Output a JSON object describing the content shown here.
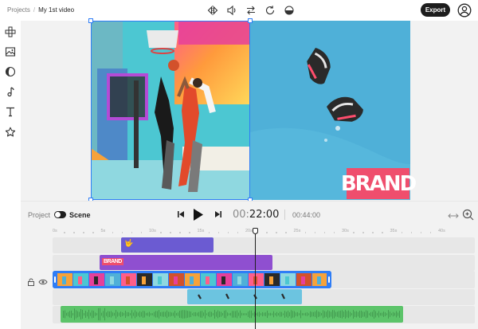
{
  "breadcrumb": {
    "parent": "Projects",
    "separator": "/",
    "current": "My 1st video"
  },
  "toolbar": {
    "icons": [
      "flip-horizontal-icon",
      "volume-icon",
      "swap-icon",
      "rotate-icon",
      "opacity-icon"
    ],
    "export_label": "Export",
    "account_icon": "user-circle-icon"
  },
  "sidebar": {
    "items": [
      {
        "name": "elements",
        "icon": "elements-icon"
      },
      {
        "name": "media",
        "icon": "media-icon"
      },
      {
        "name": "filters",
        "icon": "filter-icon"
      },
      {
        "name": "music",
        "icon": "music-note-icon"
      },
      {
        "name": "text",
        "icon": "text-icon"
      },
      {
        "name": "stickers",
        "icon": "star-icon"
      }
    ]
  },
  "canvas": {
    "brand_text": "BRAND",
    "brand_color": "#ef4e6d",
    "accent": "#2f7df6"
  },
  "controls": {
    "project_label": "Project",
    "scene_label": "Scene",
    "scene_toggle_on": true,
    "current_time_prefix": "00:",
    "current_time_main": "22:00",
    "total_time": "00:44:00"
  },
  "timeline": {
    "ticks": [
      "0s",
      "5s",
      "10s",
      "15s",
      "20s",
      "25s",
      "30s",
      "35s",
      "40s"
    ],
    "tracks": [
      {
        "type": "sticker",
        "color": "#6b5bd2",
        "label": "🤟"
      },
      {
        "type": "logo",
        "color": "#8f4fd0",
        "label": "BRAND"
      },
      {
        "type": "video",
        "color": "#2f7df6",
        "selected": true
      },
      {
        "type": "video-overlay",
        "color": "#7fd3e8"
      },
      {
        "type": "audio",
        "color": "#5cc46a"
      }
    ]
  }
}
